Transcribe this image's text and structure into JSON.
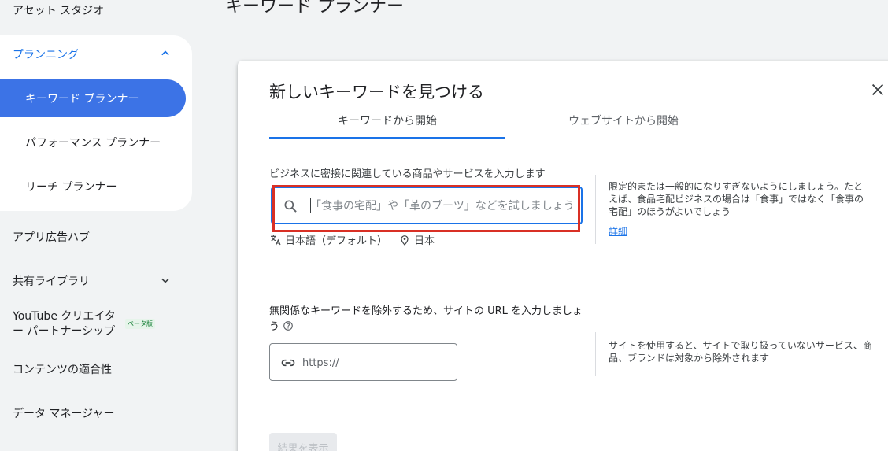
{
  "page_title": "キーワード プランナー",
  "sidebar": {
    "top_item": "アセット スタジオ",
    "planning": {
      "label": "プランニング",
      "expanded": true
    },
    "planning_items": [
      {
        "label": "キーワード プランナー",
        "active": true
      },
      {
        "label": "パフォーマンス プランナー"
      },
      {
        "label": "リーチ プランナー"
      }
    ],
    "app_hub": "アプリ広告ハブ",
    "shared_library": "共有ライブラリ",
    "youtube": "YouTube クリエイター パートナーシップ",
    "beta_badge": "ベータ版",
    "content_suitability": "コンテンツの適合性",
    "data_manager": "データ マネージャー"
  },
  "dialog": {
    "title": "新しいキーワードを見つける",
    "tabs": [
      {
        "label": "キーワードから開始",
        "selected": true
      },
      {
        "label": "ウェブサイトから開始",
        "selected": false
      }
    ],
    "keyword_section": {
      "label": "ビジネスに密接に関連している商品やサービスを入力します",
      "placeholder": "「食事の宅配」や「革のブーツ」などを試しましょう",
      "language": "日本語（デフォルト）",
      "location": "日本",
      "help_text": "限定的または一般的になりすぎないようにしましょう。たとえば、食品宅配ビジネスの場合は「食事」ではなく「食事の宅配」のほうがよいでしょう",
      "help_link": "詳細"
    },
    "url_section": {
      "label": "無関係なキーワードを除外するため、サイトの URL を入力しましょう",
      "placeholder": "https://",
      "help_text": "サイトを使用すると、サイトで取り扱っていないサービス、商品、ブランドは対象から除外されます"
    },
    "submit_label": "結果を表示"
  },
  "colors": {
    "accent": "#1a73e8",
    "active_nav": "#3c73e6",
    "highlight_box": "#d93025"
  }
}
